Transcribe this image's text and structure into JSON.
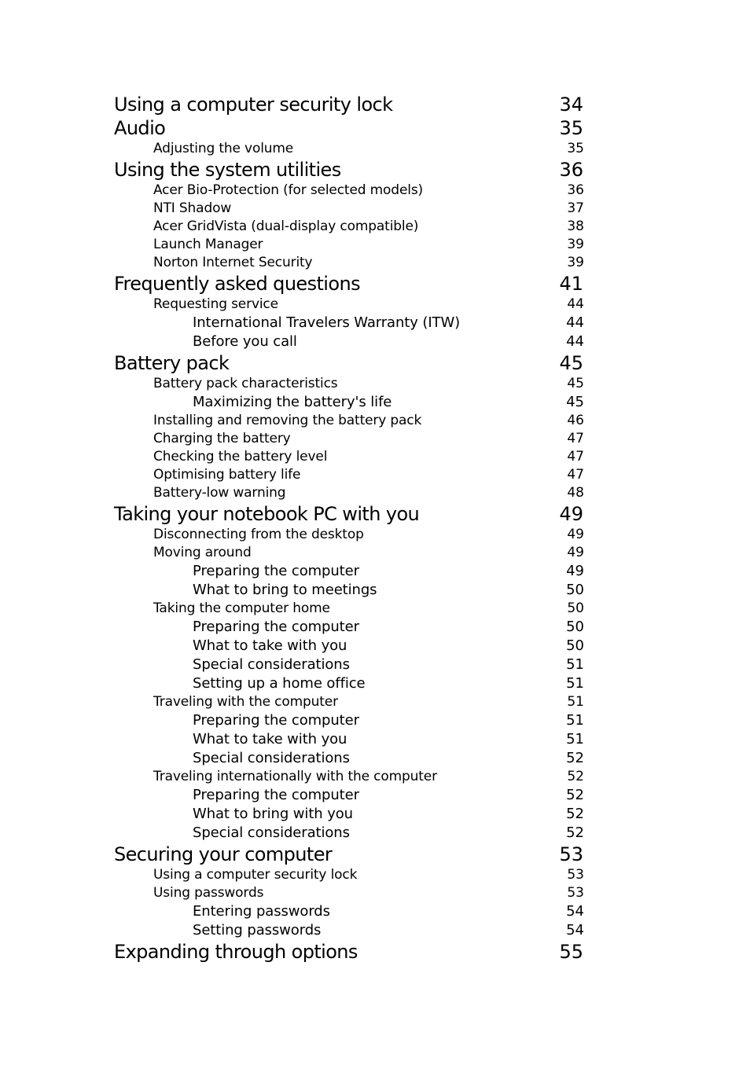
{
  "toc": [
    {
      "level": 1,
      "title": "Using a computer security lock",
      "page": "34"
    },
    {
      "level": 1,
      "title": "Audio",
      "page": "35"
    },
    {
      "level": 2,
      "title": "Adjusting the volume",
      "page": "35"
    },
    {
      "level": 1,
      "title": "Using the system utilities",
      "page": "36"
    },
    {
      "level": 2,
      "title": "Acer Bio-Protection (for selected models)",
      "page": "36"
    },
    {
      "level": 2,
      "title": "NTI Shadow",
      "page": "37"
    },
    {
      "level": 2,
      "title": "Acer GridVista (dual-display compatible)",
      "page": "38"
    },
    {
      "level": 2,
      "title": "Launch Manager",
      "page": "39"
    },
    {
      "level": 2,
      "title": "Norton Internet Security",
      "page": "39"
    },
    {
      "level": 1,
      "title": "Frequently asked questions",
      "page": "41"
    },
    {
      "level": 2,
      "title": "Requesting service",
      "page": "44"
    },
    {
      "level": 3,
      "title": "International Travelers Warranty (ITW)",
      "page": "44"
    },
    {
      "level": 3,
      "title": "Before you call",
      "page": "44"
    },
    {
      "level": 1,
      "title": "Battery pack",
      "page": "45"
    },
    {
      "level": 2,
      "title": "Battery pack characteristics",
      "page": "45"
    },
    {
      "level": 3,
      "title": "Maximizing the battery's life",
      "page": "45"
    },
    {
      "level": 2,
      "title": "Installing and removing the battery pack",
      "page": "46"
    },
    {
      "level": 2,
      "title": "Charging the battery",
      "page": "47"
    },
    {
      "level": 2,
      "title": "Checking the battery level",
      "page": "47"
    },
    {
      "level": 2,
      "title": "Optimising battery life",
      "page": "47"
    },
    {
      "level": 2,
      "title": "Battery-low warning",
      "page": "48"
    },
    {
      "level": 1,
      "title": "Taking your notebook PC with you",
      "page": "49"
    },
    {
      "level": 2,
      "title": "Disconnecting from the desktop",
      "page": "49"
    },
    {
      "level": 2,
      "title": "Moving around",
      "page": "49"
    },
    {
      "level": 3,
      "title": "Preparing the computer",
      "page": "49"
    },
    {
      "level": 3,
      "title": "What to bring to meetings",
      "page": "50"
    },
    {
      "level": 2,
      "title": "Taking the computer home",
      "page": "50"
    },
    {
      "level": 3,
      "title": "Preparing the computer",
      "page": "50"
    },
    {
      "level": 3,
      "title": "What to take with you",
      "page": "50"
    },
    {
      "level": 3,
      "title": "Special considerations",
      "page": "51"
    },
    {
      "level": 3,
      "title": "Setting up a home office",
      "page": "51"
    },
    {
      "level": 2,
      "title": "Traveling with the computer",
      "page": "51"
    },
    {
      "level": 3,
      "title": "Preparing the computer",
      "page": "51"
    },
    {
      "level": 3,
      "title": "What to take with you",
      "page": "51"
    },
    {
      "level": 3,
      "title": "Special considerations",
      "page": "52"
    },
    {
      "level": 2,
      "title": "Traveling internationally with the computer",
      "page": "52"
    },
    {
      "level": 3,
      "title": "Preparing the computer",
      "page": "52"
    },
    {
      "level": 3,
      "title": "What to bring with you",
      "page": "52"
    },
    {
      "level": 3,
      "title": "Special considerations",
      "page": "52"
    },
    {
      "level": 1,
      "title": "Securing your computer",
      "page": "53"
    },
    {
      "level": 2,
      "title": "Using a computer security lock",
      "page": "53"
    },
    {
      "level": 2,
      "title": "Using passwords",
      "page": "53"
    },
    {
      "level": 3,
      "title": "Entering passwords",
      "page": "54"
    },
    {
      "level": 3,
      "title": "Setting passwords",
      "page": "54"
    },
    {
      "level": 1,
      "title": "Expanding through options",
      "page": "55"
    }
  ]
}
